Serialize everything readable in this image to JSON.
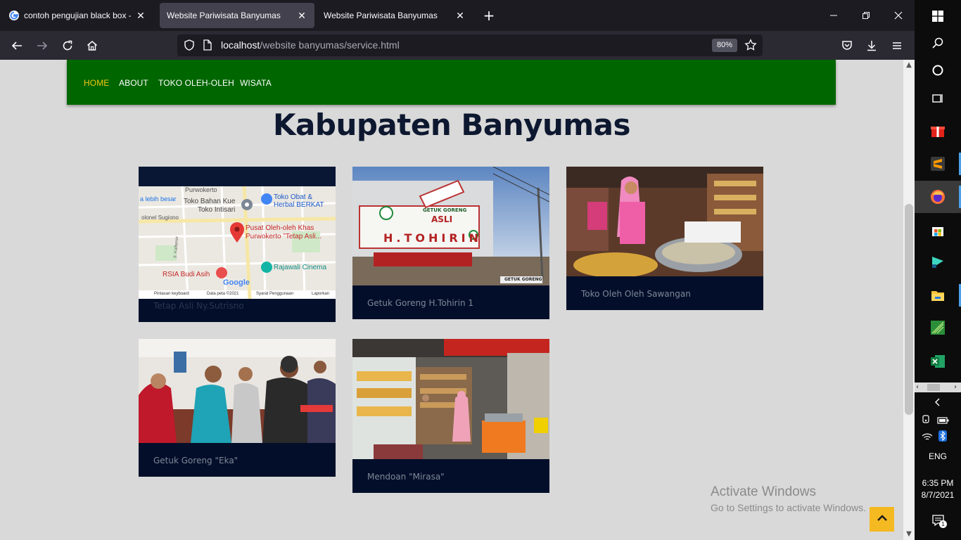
{
  "browser": {
    "tabs": [
      {
        "label": "contoh pengujian black box - P",
        "active": false
      },
      {
        "label": "Website Pariwisata Banyumas",
        "active": true
      },
      {
        "label": "Website Pariwisata Banyumas",
        "active": false
      }
    ],
    "url_host": "localhost",
    "url_path": "/website banyumas/service.html",
    "zoom": "80%"
  },
  "site": {
    "nav": [
      {
        "label": "HOME",
        "active": true
      },
      {
        "label": "ABOUT",
        "active": false
      },
      {
        "label": "TOKO OLEH-OLEH",
        "active": false
      },
      {
        "label": "WISATA",
        "active": false
      }
    ],
    "title": "Kabupaten Banyumas",
    "cards": [
      {
        "caption": "Tetap Asli Ny.Sutrisno",
        "map": {
          "label_large": "a lebih besar",
          "place_1": "Toko Bahan Kue",
          "place_2": "Toko Intisari",
          "place_3": "Toko Obat &",
          "place_4": "Herbal BERKAT",
          "pin_1": "Pusat Oleh-oleh Khas",
          "pin_2": "Purwokerto \"Tetap Asli...",
          "place_5": "Rajawali Cinema",
          "place_6": "RSIA Budi Asih",
          "street_1": "Purwokerto",
          "street_2": "olonel Sugiono",
          "street_3": "Jl. Kaliberer",
          "logo": "Google",
          "footer_1": "Pintasan keyboard",
          "footer_2": "Data peta ©2021",
          "footer_3": "Syarat Penggunaan",
          "footer_4": "Laporkan"
        }
      },
      {
        "caption": "Getuk Goreng H.Tohirin 1",
        "sign_1": "GETUK GORENG",
        "sign_2": "ASLI",
        "sign_3": "H.TOHIRIN",
        "sign_4": "GETUK GORENG"
      },
      {
        "caption": "Toko Oleh Oleh Sawangan"
      },
      {
        "caption": "Getuk Goreng \"Eka\""
      },
      {
        "caption": "Mendoan \"Mirasa\""
      }
    ]
  },
  "overlay": {
    "activate_line1": "Activate Windows",
    "activate_line2": "Go to Settings to activate Windows."
  },
  "taskbar": {
    "lang": "ENG",
    "time": "6:35 PM",
    "date": "8/7/2021",
    "notifications": "1"
  }
}
